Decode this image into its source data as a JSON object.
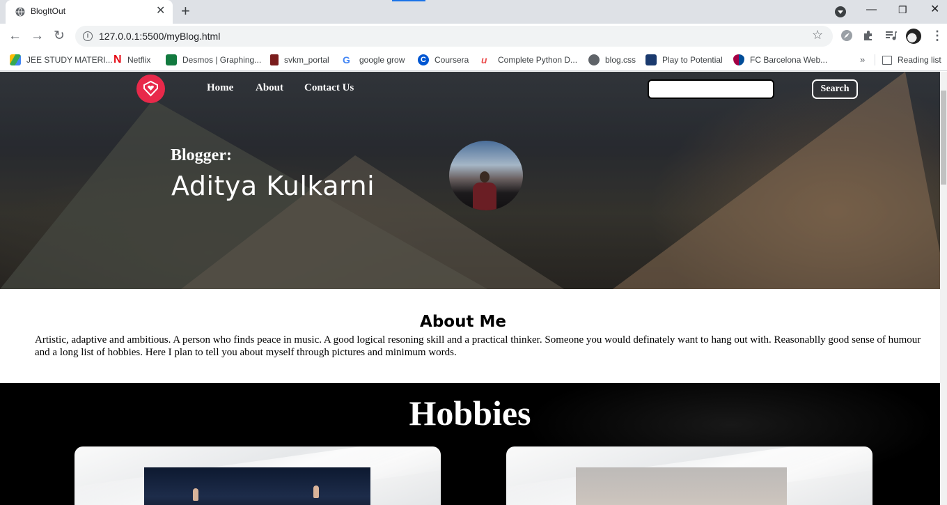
{
  "browser": {
    "tab_title": "BlogItOut",
    "url": "127.0.0.1:5500/myBlog.html",
    "bookmarks": [
      {
        "label": "JEE STUDY MATERI...",
        "icon": "google-drive-icon",
        "color": "#34a853"
      },
      {
        "label": "Netflix",
        "icon": "netflix-icon",
        "color": "#e50914"
      },
      {
        "label": "Desmos | Graphing...",
        "icon": "desmos-icon",
        "color": "#127a3f"
      },
      {
        "label": "svkm_portal",
        "icon": "svkm-icon",
        "color": "#7a1c1c"
      },
      {
        "label": "google grow",
        "icon": "google-icon",
        "color": "#4285f4"
      },
      {
        "label": "Coursera",
        "icon": "coursera-icon",
        "color": "#0056d2"
      },
      {
        "label": "Complete Python D...",
        "icon": "udemy-icon",
        "color": "#ec5252"
      },
      {
        "label": "blog.css",
        "icon": "globe-icon",
        "color": "#5f6368"
      },
      {
        "label": "Play to Potential",
        "icon": "play-to-potential-icon",
        "color": "#1a3a6e"
      },
      {
        "label": "FC Barcelona Web...",
        "icon": "fcb-icon",
        "color": "#a50044"
      }
    ],
    "reading_list": "Reading list",
    "more_bookmarks": "»"
  },
  "nav": {
    "links": [
      "Home",
      "About",
      "Contact Us"
    ],
    "search_placeholder": "",
    "search_button": "Search"
  },
  "hero": {
    "label": "Blogger:",
    "name": "Aditya Kulkarni"
  },
  "about": {
    "title": "About Me",
    "text": "Artistic, adaptive and ambitious. A person who finds peace in music. A good logical resoning skill and a practical thinker. Someone you would definately want to hang out with. Reasonablly good sense of humour and a long list of hobbies. Here I plan to tell you about myself through pictures and minimum words."
  },
  "hobbies": {
    "title": "Hobbies"
  },
  "colors": {
    "logo": "#e8294a",
    "hobbies_bg": "#000000"
  }
}
